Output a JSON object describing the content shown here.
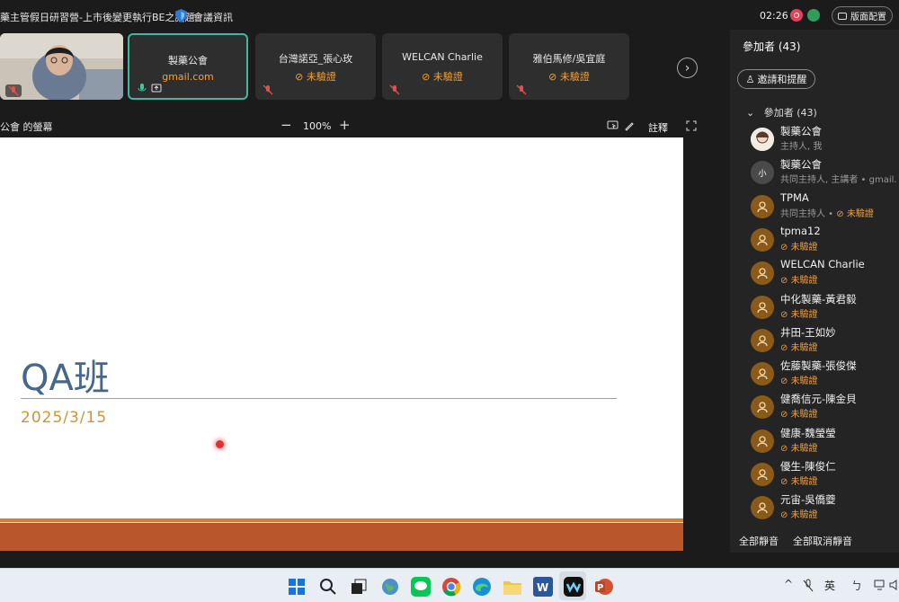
{
  "window": {
    "title": "藥主管假日研習營-上市後變更執行BE之議題",
    "meeting_info": "會議資訊",
    "timer": "02:26",
    "layout_label": "版面配置"
  },
  "tiles": [
    {
      "name": "製藥公會",
      "sub": "gmail.com"
    },
    {
      "name": "台灣諾亞_張心玫",
      "status": "未驗證"
    },
    {
      "name": "WELCAN Charlie",
      "status": "未驗證"
    },
    {
      "name": "雅伯馬修/吳宜庭",
      "status": "未驗證"
    }
  ],
  "share": {
    "label": "公會 的螢幕",
    "zoom": "100%",
    "annotate": "註釋"
  },
  "slide": {
    "title": "QA班",
    "date": "2025/3/15"
  },
  "panel": {
    "title": "參加者 (43)",
    "invite": "邀請和提醒",
    "section": "參加者 (43)",
    "participants": [
      {
        "name": "製藥公會",
        "sub": "主持人, 我"
      },
      {
        "name": "製藥公會",
        "sub": "共同主持人, 主講者 • gmail.",
        "avatar_text": "小"
      },
      {
        "name": "TPMA",
        "sub": "共同主持人 • ",
        "status": "未驗證"
      },
      {
        "name": "tpma12",
        "status": "未驗證"
      },
      {
        "name": "WELCAN Charlie",
        "status": "未驗證"
      },
      {
        "name": "中化製藥-黃君毅",
        "status": "未驗證"
      },
      {
        "name": "井田-王如妙",
        "status": "未驗證"
      },
      {
        "name": "佐藤製藥-張俊傑",
        "status": "未驗證"
      },
      {
        "name": "健喬信元-陳金貝",
        "status": "未驗證"
      },
      {
        "name": "健康-魏瑩瑩",
        "status": "未驗證"
      },
      {
        "name": "優生-陳俊仁",
        "status": "未驗證"
      },
      {
        "name": "元宙-吳僑夔",
        "status": "未驗證"
      }
    ],
    "mute_all": "全部靜音",
    "unmute_all": "全部取消靜音"
  },
  "taskbar": {
    "ime": "英"
  }
}
